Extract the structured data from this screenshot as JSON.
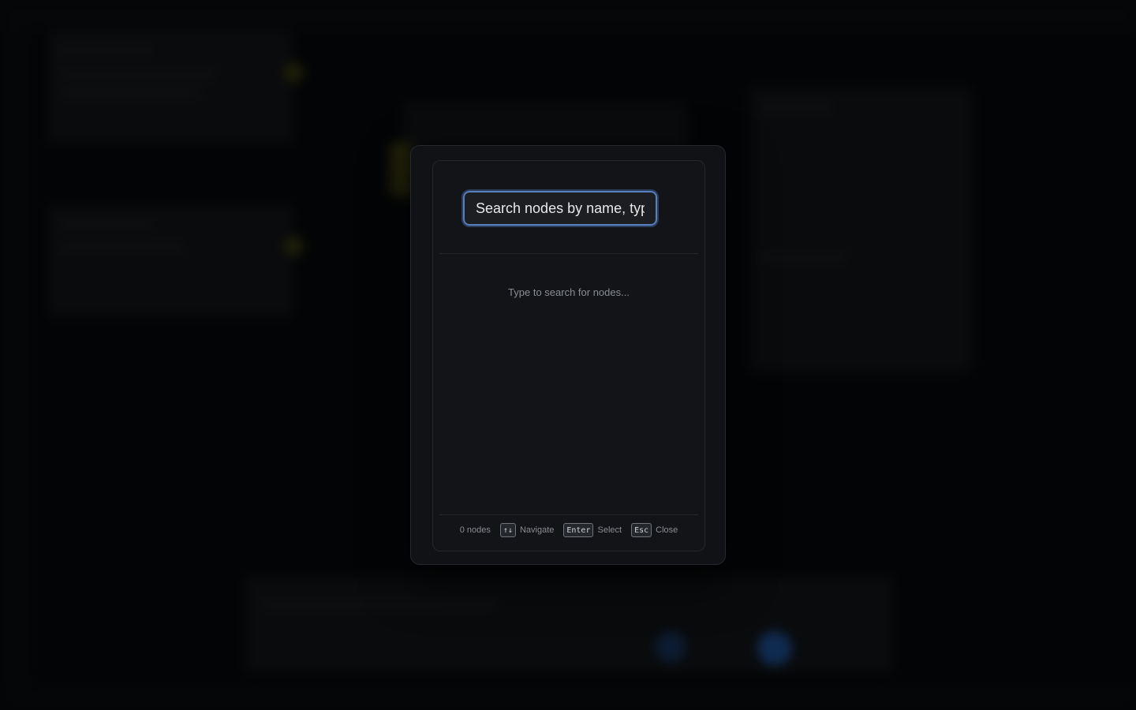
{
  "search": {
    "placeholder": "Search nodes by name, type, or content...",
    "value": ""
  },
  "results": {
    "empty_message": "Type to search for nodes..."
  },
  "footer": {
    "count_text": "0 nodes",
    "hints": [
      {
        "key": "↑↓",
        "label": "Navigate"
      },
      {
        "key": "Enter",
        "label": "Select"
      },
      {
        "key": "Esc",
        "label": "Close"
      }
    ]
  },
  "colors": {
    "accent": "#5a7fbf",
    "modal_bg": "#121417",
    "backdrop": "#07090b"
  }
}
